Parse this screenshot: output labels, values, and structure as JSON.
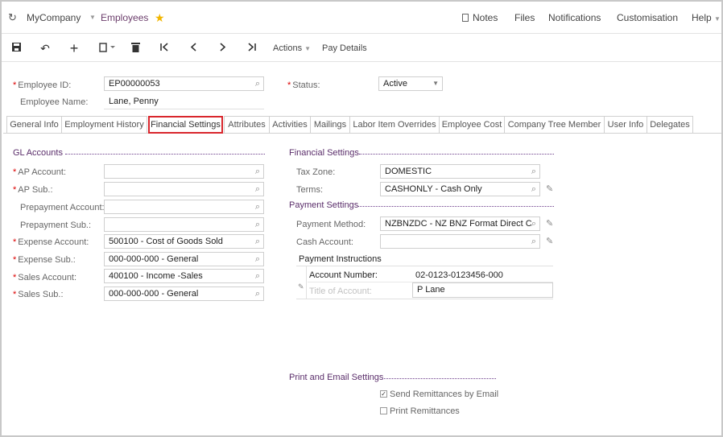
{
  "topbar": {
    "company": "MyCompany",
    "screen": "Employees",
    "links": [
      "Notes",
      "Files",
      "Notifications",
      "Customisation",
      "Help"
    ]
  },
  "toolbar": {
    "actions_label": "Actions",
    "pay_details_label": "Pay Details"
  },
  "header": {
    "employee_id_label": "Employee ID:",
    "employee_id": "EP00000053",
    "status_label": "Status:",
    "status": "Active",
    "employee_name_label": "Employee Name:",
    "employee_name": "Lane, Penny"
  },
  "tabs": [
    "General Info",
    "Employment History",
    "Financial Settings",
    "Attributes",
    "Activities",
    "Mailings",
    "Labor Item Overrides",
    "Employee Cost",
    "Company Tree Member",
    "User Info",
    "Delegates"
  ],
  "gl": {
    "title": "GL Accounts",
    "fields": [
      {
        "label": "AP Account:",
        "value": "",
        "required": true
      },
      {
        "label": "AP Sub.:",
        "value": "",
        "required": true
      },
      {
        "label": "Prepayment Account:",
        "value": "",
        "required": false
      },
      {
        "label": "Prepayment Sub.:",
        "value": "",
        "required": false
      },
      {
        "label": "Expense Account:",
        "value": "500100 - Cost of Goods Sold",
        "required": true
      },
      {
        "label": "Expense Sub.:",
        "value": "000-000-000 - General",
        "required": true
      },
      {
        "label": "Sales Account:",
        "value": "400100 - Income -Sales",
        "required": true
      },
      {
        "label": "Sales Sub.:",
        "value": "000-000-000 - General",
        "required": true
      }
    ]
  },
  "financial": {
    "title": "Financial Settings",
    "tax_zone_label": "Tax Zone:",
    "tax_zone": "DOMESTIC",
    "terms_label": "Terms:",
    "terms": "CASHONLY - Cash Only"
  },
  "payment": {
    "title": "Payment Settings",
    "method_label": "Payment Method:",
    "method": "NZBNZDC - NZ BNZ Format Direct Cr",
    "cash_account_label": "Cash Account:",
    "cash_account": "",
    "instructions_title": "Payment Instructions",
    "account_number_label": "Account Number:",
    "account_number": "02-0123-0123456-000",
    "title_of_account_label": "Title of Account:",
    "title_of_account": "P Lane"
  },
  "print": {
    "title": "Print and Email Settings",
    "send_email_label": "Send Remittances by Email",
    "send_email_checked": true,
    "print_label": "Print Remittances",
    "print_checked": false
  }
}
